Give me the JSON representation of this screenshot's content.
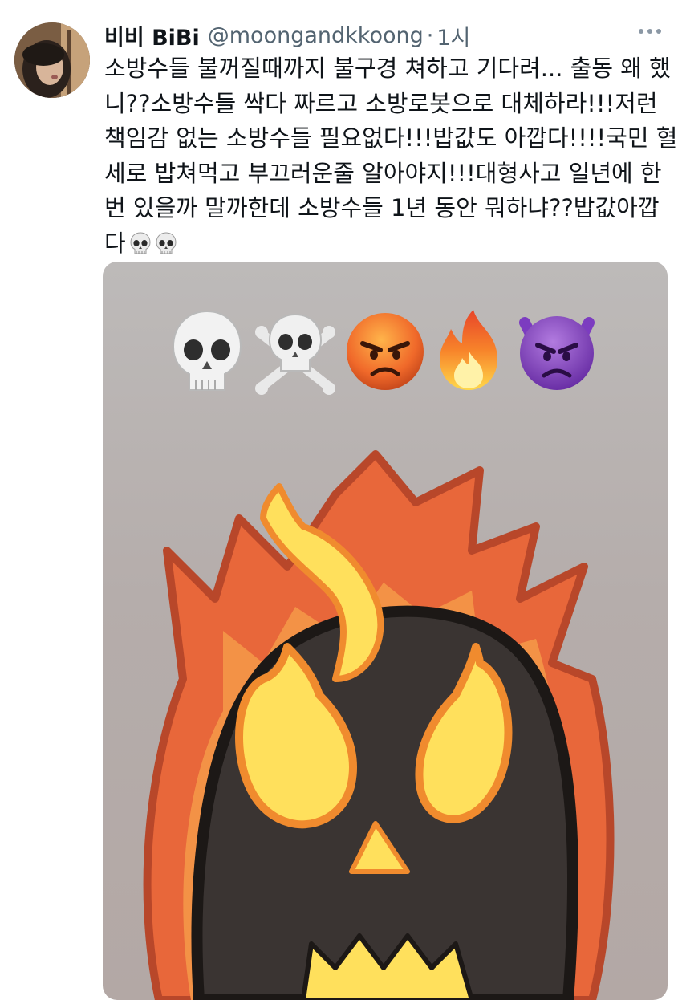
{
  "tweet": {
    "author": {
      "display_name": "비비 BiBi",
      "handle": "@moongandkkoong",
      "separator": "·",
      "time": "1시",
      "avatar_icon": "avatar-photo"
    },
    "text_lines": [
      "소방수들 불꺼질때까지 불구경 쳐하고 기다려... 출동 왜 했",
      "니??소방수들 싹다 짜르고 소방로봇으로 대체하라!!!저런",
      "책임감 없는 소방수들 필요없다!!!밥값도 아깝다!!!!국민 혈",
      "세로 밥쳐먹고 부끄러운줄 알아야지!!!대형사고 일년에 한",
      "번 있을까 말까한데 소방수들 1년 동안 뭐하냐??밥값아깝",
      "다"
    ],
    "text_trailing_icons": [
      "skull-emoji",
      "skull-emoji"
    ],
    "more_icon": "more-horizontal-icon",
    "media": {
      "emoji_row": [
        "skull-emoji",
        "skull-crossbones-emoji",
        "angry-face-emoji",
        "fire-emoji",
        "angry-devil-emoji"
      ],
      "main_image": "flaming-skull-sticker"
    }
  }
}
